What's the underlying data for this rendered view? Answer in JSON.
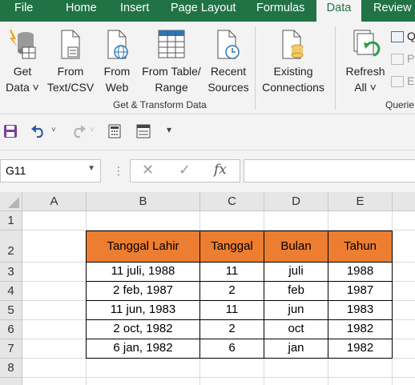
{
  "tabs": [
    "File",
    "Home",
    "Insert",
    "Page Layout",
    "Formulas",
    "Data",
    "Review"
  ],
  "active_tab": "Data",
  "ribbon": {
    "get_data": {
      "line1": "Get",
      "line2": "Data ˅"
    },
    "from_text_csv": {
      "line1": "From",
      "line2": "Text/CSV"
    },
    "from_web": {
      "line1": "From",
      "line2": "Web"
    },
    "from_table": {
      "line1": "From Table/",
      "line2": "Range"
    },
    "recent_sources": {
      "line1": "Recent",
      "line2": "Sources"
    },
    "existing_connections": {
      "line1": "Existing",
      "line2": "Connections"
    },
    "refresh_all": {
      "line1": "Refresh",
      "line2": "All ˅"
    },
    "group_get_transform": "Get & Transform Data",
    "group_queries": "Querie",
    "queries_small": [
      "Q",
      "P",
      "E"
    ]
  },
  "formula_bar": {
    "name_box": "G11",
    "fx_label": "fx",
    "formula": ""
  },
  "columns": [
    "A",
    "B",
    "C",
    "D",
    "E"
  ],
  "rows": [
    "1",
    "2",
    "3",
    "4",
    "5",
    "6",
    "7",
    "8"
  ],
  "table": {
    "headers": [
      "Tanggal Lahir",
      "Tanggal",
      "Bulan",
      "Tahun"
    ],
    "rows": [
      [
        "11 juli, 1988",
        "11",
        "juli",
        "1988"
      ],
      [
        "2 feb, 1987",
        "2",
        "feb",
        "1987"
      ],
      [
        "11 jun, 1983",
        "11",
        "jun",
        "1983"
      ],
      [
        "2 oct, 1982",
        "2",
        "oct",
        "1982"
      ],
      [
        "6 jan, 1982",
        "6",
        "jan",
        "1982"
      ]
    ]
  },
  "colors": {
    "excel_green": "#217346",
    "header_fill": "#ed7d31"
  }
}
